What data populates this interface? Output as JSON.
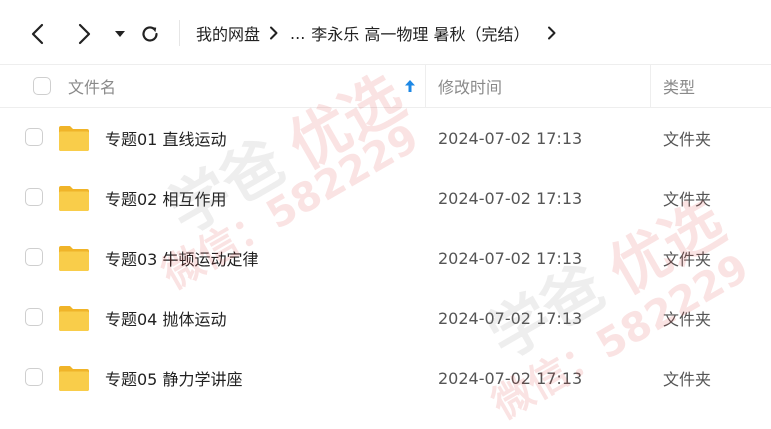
{
  "toolbar": {
    "back_icon": "chevron-left-icon",
    "forward_icon": "chevron-right-icon",
    "dropdown_icon": "caret-down-icon",
    "refresh_icon": "refresh-icon"
  },
  "breadcrumb": {
    "root": "我的网盘",
    "ellipsis": "...",
    "current": "李永乐 高一物理 暑秋（完结）"
  },
  "list": {
    "columns": {
      "name": "文件名",
      "modified": "修改时间",
      "type": "类型"
    },
    "sort_icon": "arrow-up-icon",
    "rows": [
      {
        "name": "专题01 直线运动",
        "modified": "2024-07-02 17:13",
        "type": "文件夹"
      },
      {
        "name": "专题02 相互作用",
        "modified": "2024-07-02 17:13",
        "type": "文件夹"
      },
      {
        "name": "专题03 牛顿运动定律",
        "modified": "2024-07-02 17:13",
        "type": "文件夹"
      },
      {
        "name": "专题04 抛体运动",
        "modified": "2024-07-02 17:13",
        "type": "文件夹"
      },
      {
        "name": "专题05 静力学讲座",
        "modified": "2024-07-02 17:13",
        "type": "文件夹"
      }
    ]
  },
  "watermark": {
    "text_gray": "学爸",
    "text_red": "优选",
    "text_id": "微信：582229"
  },
  "colors": {
    "accent": "#1e88e5",
    "folder": "#f7c33c",
    "folder_back": "#f0b429",
    "text_primary": "#222222",
    "text_secondary": "#8a8a8a"
  }
}
